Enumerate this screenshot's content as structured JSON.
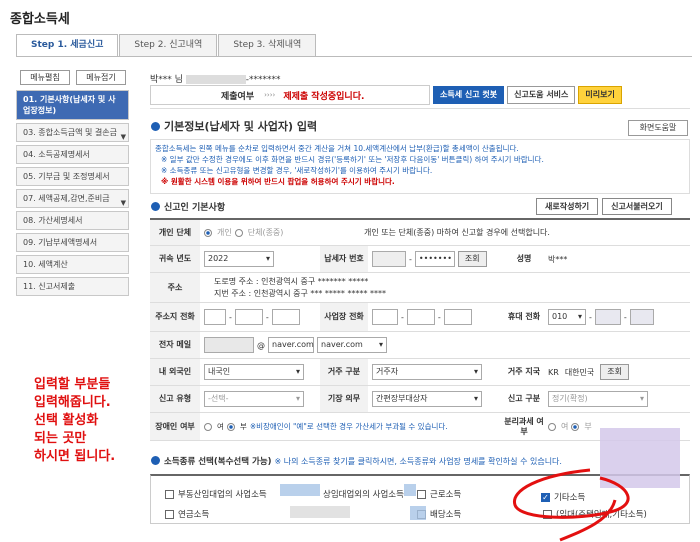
{
  "page_title": "종합소득세",
  "tabs": [
    {
      "label": "Step 1. 세금신고"
    },
    {
      "label": "Step 2. 신고내역"
    },
    {
      "label": "Step 3. 삭제내역"
    }
  ],
  "menu_buttons": {
    "open": "메뉴펼침",
    "close": "메뉴접기"
  },
  "sidebar": [
    {
      "label": "01. 기본사항(납세자 및 사업장정보)"
    },
    {
      "label": "03. 종합소득금액 및 결손금"
    },
    {
      "label": "04. 소득공제명세서"
    },
    {
      "label": "05. 기부금 및 조정명세서"
    },
    {
      "label": "07. 세액공제,감면,준비금"
    },
    {
      "label": "08. 가산세명세서"
    },
    {
      "label": "09. 기납부세액명세서"
    },
    {
      "label": "10. 세액계산"
    },
    {
      "label": "11. 신고서제출"
    }
  ],
  "annotation": [
    "입력할 부분들",
    "입력해줍니다.",
    "선택 활성화",
    "되는 곳만",
    "하시면 됩니다."
  ],
  "user": {
    "name": "박*** 님",
    "id": "-*******"
  },
  "status": {
    "label": "제출여부",
    "arrow": "››››",
    "state": "제제출 작성중입니다."
  },
  "top_buttons": {
    "shortcut": "소득세 신고 컷봇",
    "help_service": "신고도움 서비스",
    "preview": "미리보기"
  },
  "section1": {
    "title": "기본정보(납세자 및 사업자) 입력",
    "help_button": "화면도움말"
  },
  "notice": {
    "line1": "종합소득세는 왼쪽 메뉴를 순차로 입력하면서 중간 계산을 거쳐 10.세액계산에서 납부(환급)할 총세액이 산출됩니다.",
    "line2": "※ 일부 값만 수정한 경우에도 이후 화면을 반드시 경유('등록하기' 또는 '저장후 다음이동' 버튼클릭) 하여 주시기 바랍니다.",
    "line3": "※ 소득종류 또는 신고유형을 변경할 경우, '새로작성하기'를 이용하여 주시기 바랍니다.",
    "line4": "※ 원활한 시스템 이용을 위하여 반드시 팝업을 허용하여 주시기 바랍니다."
  },
  "section2": {
    "title": "신고인 기본사항",
    "new_button": "새로작성하기",
    "load_button": "신고서불러오기"
  },
  "form": {
    "individual_group": {
      "label": "개인 단체",
      "opt1": "개인",
      "opt2": "단체(종중)",
      "hint": "개인 또는 단체(종중) 마하여 신고할 경우에 선택합니다."
    },
    "year": {
      "label": "귀속 년도",
      "value": "2022"
    },
    "taxpayer_no": {
      "label": "납세자 번호",
      "dots": "•••••••",
      "lookup": "조회"
    },
    "name": {
      "label": "성명",
      "value": "박***"
    },
    "address": {
      "label": "주소",
      "road_label": "도로명 주소 :",
      "road": "인천광역시 중구 ******* *****",
      "jibun_label": "지번 주소 :",
      "jibun": "인천광역시 중구 *** ***** ***** ****"
    },
    "home_phone": {
      "label": "주소지 전화"
    },
    "biz_phone": {
      "label": "사업장 전화"
    },
    "mobile": {
      "label": "휴대 전화",
      "prefix": "010"
    },
    "email": {
      "label": "전자 메일",
      "at": "@",
      "domain": "naver.com",
      "domain_select": "naver.com"
    },
    "nationality": {
      "label": "내 외국인",
      "value": "내국인"
    },
    "residence": {
      "label": "거주 구분",
      "value": "거주자"
    },
    "residence_country": {
      "label": "거주 지국",
      "code": "KR",
      "country": "대한민국",
      "lookup": "조회"
    },
    "report_type": {
      "label": "신고 유형",
      "value": "-선택-"
    },
    "bookkeeping": {
      "label": "기장 의무",
      "value": "간편장부대상자"
    },
    "report_kind": {
      "label": "신고 구분",
      "value": "정기(확정)"
    },
    "disabled": {
      "label": "장애인 여부",
      "yes": "여",
      "no": "부",
      "note": "※비장애인이 \"예\"로 선택한 경우 가산세가 부과될 수 있습니다."
    },
    "separate_tax": {
      "label": "분리과세 여부",
      "yes": "여",
      "no": "부"
    }
  },
  "section3": {
    "title": "소득종류 선택(복수선택 가능)",
    "hint": "※ 나의 소득종류 찾기를 클릭하시면, 소득종류와 사업장 명세를 확인하실 수 있습니다."
  },
  "income_types": {
    "realestate": "부동산임대업의 사업소득",
    "biz_other": "상임대업외의 사업소득",
    "labor": "근로소득",
    "other": "기타소득",
    "pension": "연금소득",
    "dividend": "배당소득",
    "other2": "(임대(주택임대,기타소득)"
  },
  "colors": {
    "accent": "#1e5fb4",
    "active_side": "#3e6ab3",
    "annotation": "#e01010",
    "preview": "#ffd23c"
  }
}
